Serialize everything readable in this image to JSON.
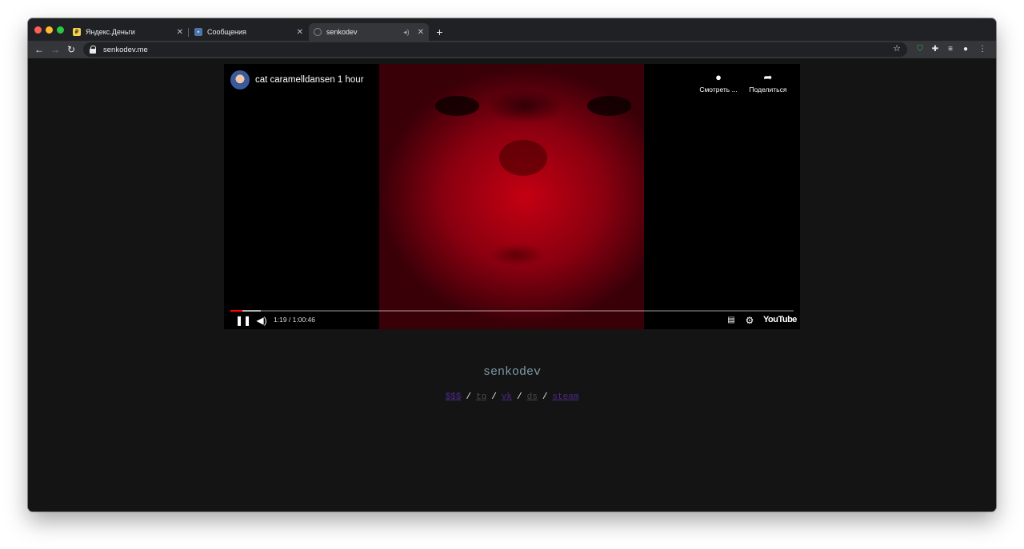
{
  "browser": {
    "tabs": [
      {
        "label": "Яндекс.Деньги",
        "icon": "yandex-money-icon",
        "active": false
      },
      {
        "label": "Сообщения",
        "icon": "vk-messages-icon",
        "active": false
      },
      {
        "label": "senkodev",
        "icon": "globe-icon",
        "active": true
      }
    ],
    "close_glyph": "✕",
    "new_tab_glyph": "+",
    "url": "senkodev.me"
  },
  "video": {
    "title": "cat caramelldansen 1 hour",
    "watch_later_label": "Смотреть ...",
    "share_label": "Поделиться",
    "current_time": "1:19",
    "duration": "1:00:46",
    "time_display": "1:19 / 1:00:46",
    "played_fraction": 0.022,
    "buffered_fraction": 0.054,
    "logo_text": "YouTube",
    "accent_color": "#ff0000"
  },
  "site": {
    "title": "senkodev",
    "links": [
      {
        "label": "$$$",
        "style": "purple"
      },
      {
        "label": "tg",
        "style": "muted"
      },
      {
        "label": "vk",
        "style": "purple"
      },
      {
        "label": "ds",
        "style": "muted"
      },
      {
        "label": "steam",
        "style": "purple"
      }
    ],
    "separator": "/"
  }
}
